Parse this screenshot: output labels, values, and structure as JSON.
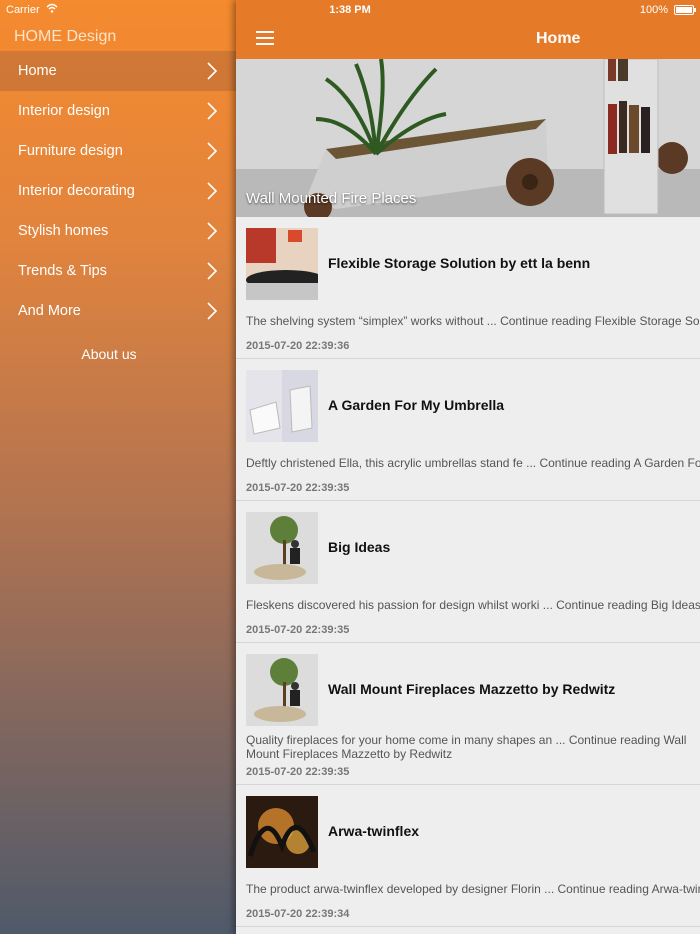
{
  "status_bar": {
    "carrier": "Carrier",
    "time": "1:38 PM",
    "battery": "100%"
  },
  "sidebar": {
    "title": "HOME Design",
    "items": [
      {
        "label": "Home"
      },
      {
        "label": "Interior design"
      },
      {
        "label": "Furniture design"
      },
      {
        "label": "Interior decorating"
      },
      {
        "label": "Stylish homes"
      },
      {
        "label": "Trends & Tips"
      },
      {
        "label": "And More"
      }
    ],
    "about": "About us"
  },
  "navbar": {
    "title": "Home"
  },
  "hero": {
    "caption": "Wall Mounted Fire Places"
  },
  "articles": [
    {
      "title": "Flexible Storage Solution by ett la benn",
      "excerpt": "The shelving system “simplex” works without ... Continue reading Flexible Storage Solution by ett la benn",
      "date": "2015-07-20 22:39:36"
    },
    {
      "title": "A Garden For My Umbrella",
      "excerpt": "Deftly christened Ella, this acrylic umbrellas stand fe ... Continue reading A Garden For My Umbrella",
      "date": "2015-07-20 22:39:35"
    },
    {
      "title": "Big Ideas",
      "excerpt": "Fleskens discovered his passion for design whilst worki ... Continue reading Big Ideas",
      "date": "2015-07-20 22:39:35"
    },
    {
      "title": "Wall Mount Fireplaces Mazzetto by Redwitz",
      "excerpt": "Quality fireplaces for your home come in many shapes an ... Continue reading Wall Mount Fireplaces Mazzetto by Redwitz",
      "date": "2015-07-20 22:39:35"
    },
    {
      "title": "Arwa-twinflex",
      "excerpt": "The product arwa-twinflex developed by designer Florin ... Continue reading Arwa-twinflex",
      "date": "2015-07-20 22:39:34"
    }
  ],
  "colors": {
    "accent": "#e57b28",
    "sidebar_top": "#f58a2e",
    "sidebar_bottom": "#4f5a6a"
  }
}
